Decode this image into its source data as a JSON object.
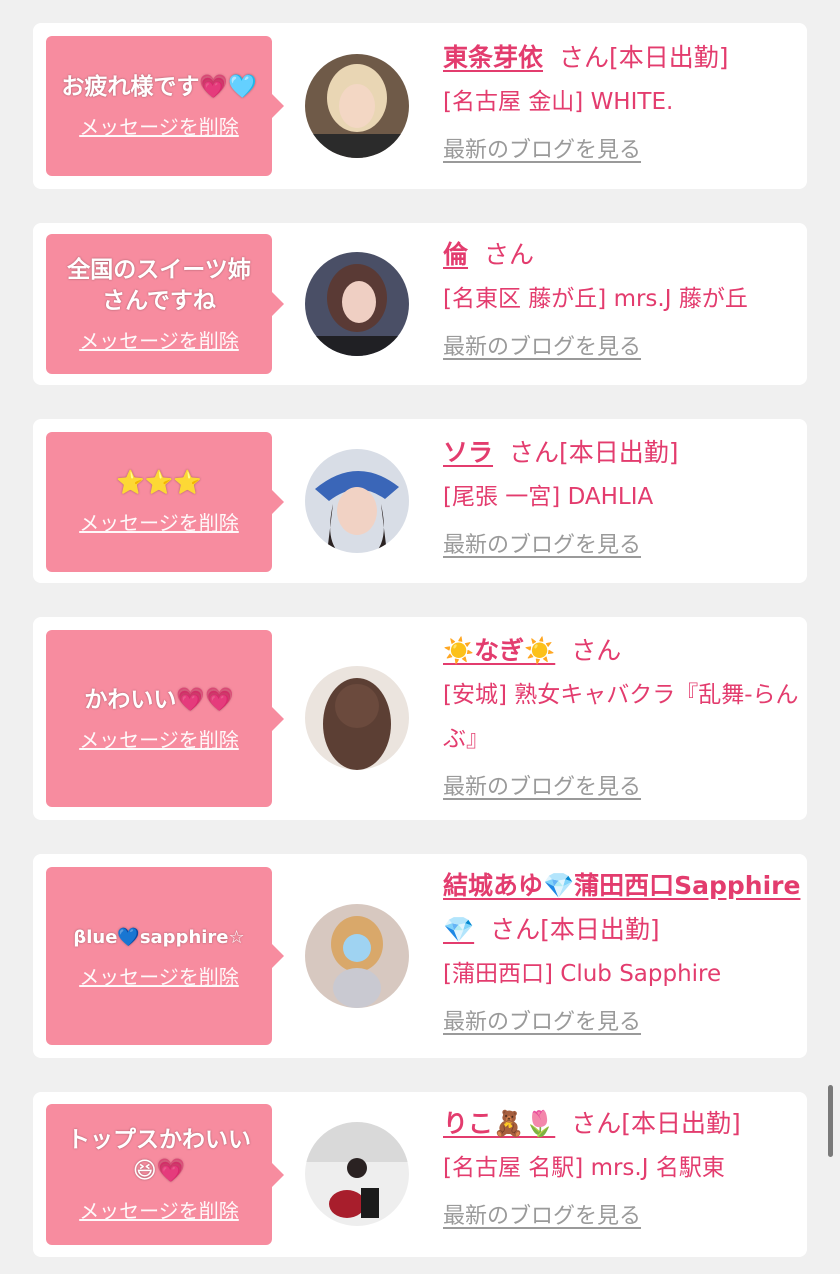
{
  "labels": {
    "delete": "メッセージを削除",
    "blog": "最新のブログを見る",
    "san": "さん"
  },
  "items": [
    {
      "message": "お疲れ様です💗🩵",
      "name": "東条芽依",
      "status": "[本日出勤]",
      "shop": "[名古屋 金山] WHITE."
    },
    {
      "message": "全国のスイーツ姉さんですね",
      "name": "倫",
      "status": "",
      "shop": "[名東区 藤が丘] mrs.J 藤が丘"
    },
    {
      "message": "⭐⭐⭐",
      "name": "ソラ",
      "status": "[本日出勤]",
      "shop": "[尾張 一宮] DAHLIA"
    },
    {
      "message": "かわいい💗💗",
      "name": "☀️なぎ☀️",
      "status": "",
      "shop": "[安城] 熟女キャバクラ『乱舞-らんぶ』"
    },
    {
      "message": "βlue💙sapphire☆",
      "name": "結城あゆ💎蒲田西口Sapphire💎",
      "status": "[本日出勤]",
      "shop": "[蒲田西口] Club Sapphire"
    },
    {
      "message": "トップスかわいい😆💗",
      "name": "りこ🧸🌷",
      "status": "[本日出勤]",
      "shop": "[名古屋 名駅] mrs.J 名駅東"
    }
  ],
  "colors": {
    "accent": "#e33c6e",
    "bubble": "#f78c9f",
    "background": "#f0f0f0",
    "link_gray": "#9a9a9a"
  }
}
